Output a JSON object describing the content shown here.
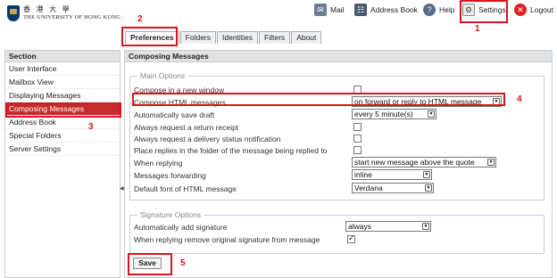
{
  "header": {
    "logo_cn": "香 港 大 學",
    "logo_en": "THE UNIVERSITY OF HONG KONG",
    "nav": {
      "mail": "Mail",
      "address_book": "Address Book",
      "help": "Help",
      "settings": "Settings",
      "logout": "Logout"
    }
  },
  "tabs": [
    "Preferences",
    "Folders",
    "Identities",
    "Filters",
    "About"
  ],
  "sidebar": {
    "heading": "Section",
    "items": [
      "User Interface",
      "Mailbox View",
      "Displaying Messages",
      "Composing Messages",
      "Address Book",
      "Special Folders",
      "Server Settings"
    ]
  },
  "main": {
    "heading": "Composing Messages",
    "main_options": {
      "legend": "Main Options",
      "rows": [
        {
          "label": "Compose in a new window",
          "type": "checkbox",
          "checked": false
        },
        {
          "label": "Compose HTML messages",
          "type": "select",
          "value": "on forward or reply to HTML message"
        },
        {
          "label": "Automatically save draft",
          "type": "select",
          "value": "every 5 minute(s)"
        },
        {
          "label": "Always request a return receipt",
          "type": "checkbox",
          "checked": false
        },
        {
          "label": "Always request a delivery status notification",
          "type": "checkbox",
          "checked": false
        },
        {
          "label": "Place replies in the folder of the message being replied to",
          "type": "checkbox",
          "checked": false
        },
        {
          "label": "When replying",
          "type": "select",
          "value": "start new message above the quote"
        },
        {
          "label": "Messages forwarding",
          "type": "select",
          "value": "inline"
        },
        {
          "label": "Default font of HTML message",
          "type": "select",
          "value": "Verdana"
        }
      ]
    },
    "signature_options": {
      "legend": "Signature Options",
      "rows": [
        {
          "label": "Automatically add signature",
          "type": "select",
          "value": "always"
        },
        {
          "label": "When replying remove original signature from message",
          "type": "checkbox",
          "checked": true
        }
      ]
    },
    "save_label": "Save"
  },
  "annotations": [
    "1",
    "2",
    "3",
    "4",
    "5"
  ],
  "colors": {
    "annotation": "#d9141e",
    "active_section": "#c42b2b"
  }
}
